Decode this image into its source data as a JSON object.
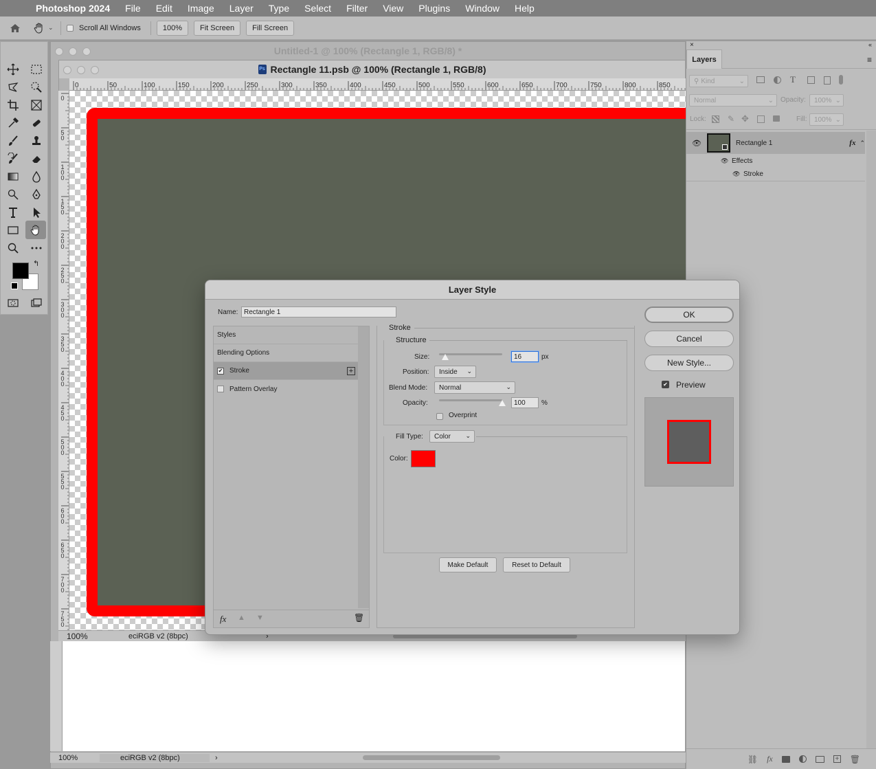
{
  "menubar": {
    "app_name": "Photoshop 2024",
    "items": [
      "File",
      "Edit",
      "Image",
      "Layer",
      "Type",
      "Select",
      "Filter",
      "View",
      "Plugins",
      "Window",
      "Help"
    ]
  },
  "options_bar": {
    "scroll_all_windows": "Scroll All Windows",
    "zoom_100": "100%",
    "fit_screen": "Fit Screen",
    "fill_screen": "Fill Screen"
  },
  "documents": {
    "back_title": "Untitled-1 @ 100% (Rectangle 1, RGB/8) *",
    "front_title": "Rectangle 11.psb @ 100% (Rectangle 1, RGB/8)",
    "front_status_zoom": "100%",
    "front_status_profile": "eciRGB v2 (8bpc)",
    "back_status_zoom": "100%",
    "back_status_profile": "eciRGB v2 (8bpc)",
    "ruler_top": [
      "0",
      "50",
      "100",
      "150",
      "200",
      "250",
      "300",
      "350",
      "400",
      "450",
      "500",
      "550",
      "600",
      "650",
      "700",
      "750",
      "800",
      "850"
    ],
    "ruler_left": [
      "0",
      "50",
      "100",
      "150",
      "200",
      "250",
      "300",
      "350",
      "400",
      "450",
      "500",
      "550",
      "600",
      "650",
      "700",
      "750"
    ]
  },
  "layers_panel": {
    "tab": "Layers",
    "filter_kind": "Kind",
    "blend_mode": "Normal",
    "opacity_label": "Opacity:",
    "opacity_value": "100%",
    "lock_label": "Lock:",
    "fill_label": "Fill:",
    "fill_value": "100%",
    "layer_name": "Rectangle 1",
    "fx_badge": "fx",
    "effects_label": "Effects",
    "stroke_effect": "Stroke"
  },
  "dialog": {
    "title": "Layer Style",
    "name_label": "Name:",
    "name_value": "Rectangle 1",
    "styles_items": [
      "Styles",
      "Blending Options",
      "Stroke",
      "Pattern Overlay"
    ],
    "stroke_section": "Stroke",
    "structure_section": "Structure",
    "size_label": "Size:",
    "size_value": "16",
    "size_unit": "px",
    "position_label": "Position:",
    "position_value": "Inside",
    "blend_mode_label": "Blend Mode:",
    "blend_mode_value": "Normal",
    "opacity_label": "Opacity:",
    "opacity_value": "100",
    "opacity_unit": "%",
    "overprint_label": "Overprint",
    "fill_type_label": "Fill Type:",
    "fill_type_value": "Color",
    "color_label": "Color:",
    "stroke_color": "#ff0000",
    "make_default": "Make Default",
    "reset_default": "Reset to Default",
    "ok": "OK",
    "cancel": "Cancel",
    "new_style": "New Style...",
    "preview_label": "Preview",
    "fx_button": "fx",
    "size_slider_fraction": 0.1,
    "opacity_slider_fraction": 1.0
  },
  "colors": {
    "shape_fill": "#5b6154",
    "stroke": "#ff0000"
  },
  "icons": {
    "home": "home-icon",
    "hand": "hand-icon",
    "trash": "trash-icon",
    "eye": "eye-icon"
  }
}
